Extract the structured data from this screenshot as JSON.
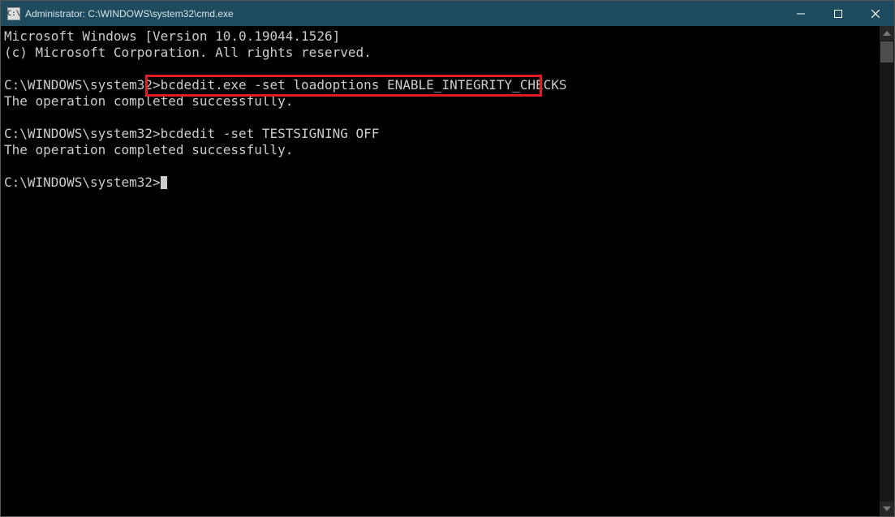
{
  "window": {
    "title": "Administrator: C:\\WINDOWS\\system32\\cmd.exe"
  },
  "terminal": {
    "lines": [
      "Microsoft Windows [Version 10.0.19044.1526]",
      "(c) Microsoft Corporation. All rights reserved.",
      "",
      "C:\\WINDOWS\\system32>bcdedit.exe -set loadoptions ENABLE_INTEGRITY_CHECKS",
      "The operation completed successfully.",
      "",
      "C:\\WINDOWS\\system32>bcdedit -set TESTSIGNING OFF",
      "The operation completed successfully.",
      "",
      "C:\\WINDOWS\\system32>"
    ],
    "highlighted_command": "bcdedit.exe -set loadoptions ENABLE_INTEGRITY_CHECKS",
    "prompt_path": "C:\\WINDOWS\\system32>",
    "command1": "bcdedit.exe -set loadoptions ENABLE_INTEGRITY_CHECKS",
    "result1": "The operation completed successfully.",
    "command2": "bcdedit -set TESTSIGNING OFF",
    "result2": "The operation completed successfully.",
    "version_line": "Microsoft Windows [Version 10.0.19044.1526]",
    "copyright_line": "(c) Microsoft Corporation. All rights reserved."
  }
}
